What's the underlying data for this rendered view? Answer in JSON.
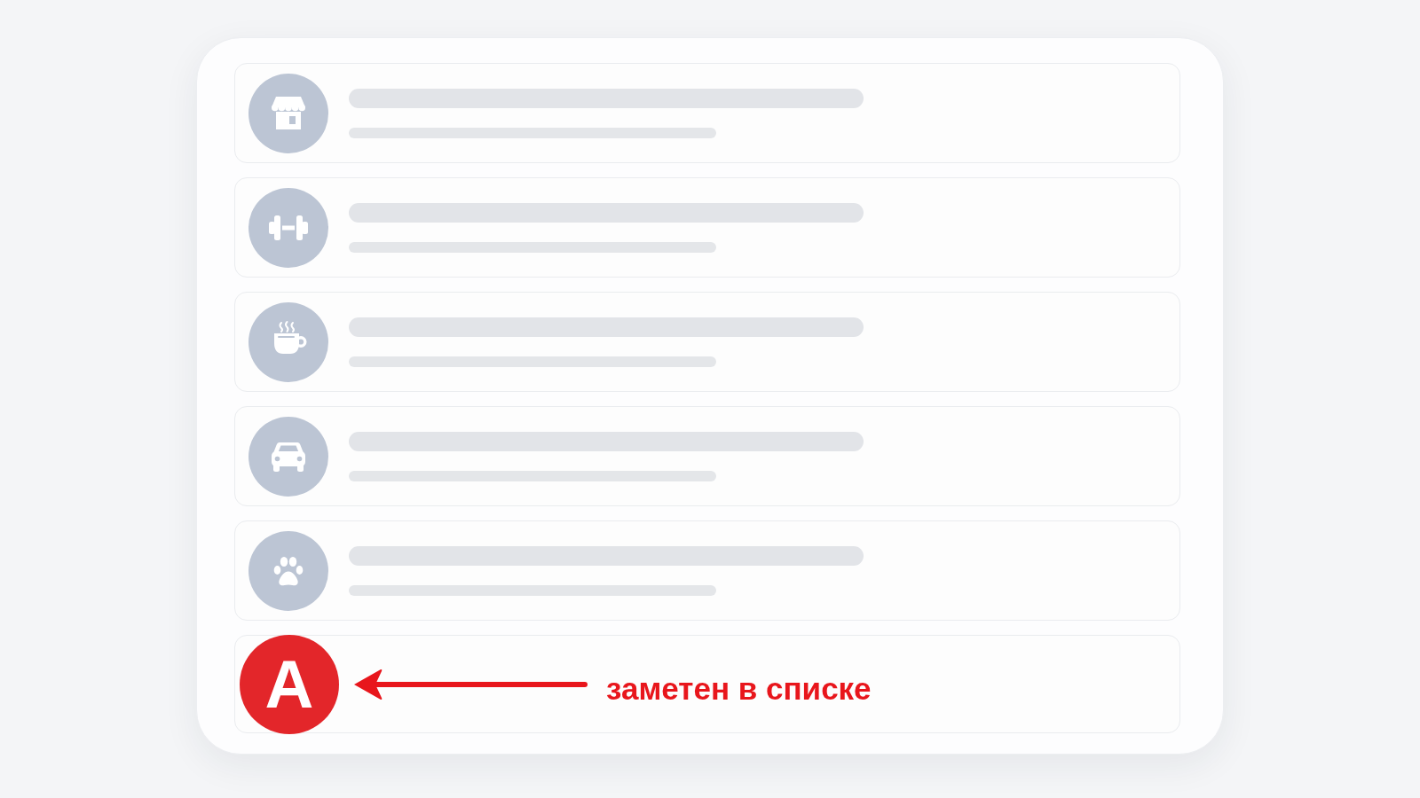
{
  "rows": [
    {
      "kind": "skeleton"
    },
    {
      "kind": "skeleton"
    },
    {
      "kind": "skeleton"
    },
    {
      "kind": "skeleton"
    },
    {
      "kind": "skeleton"
    },
    {
      "kind": "brand",
      "letter": "A",
      "callout": "заметен в списке"
    }
  ]
}
